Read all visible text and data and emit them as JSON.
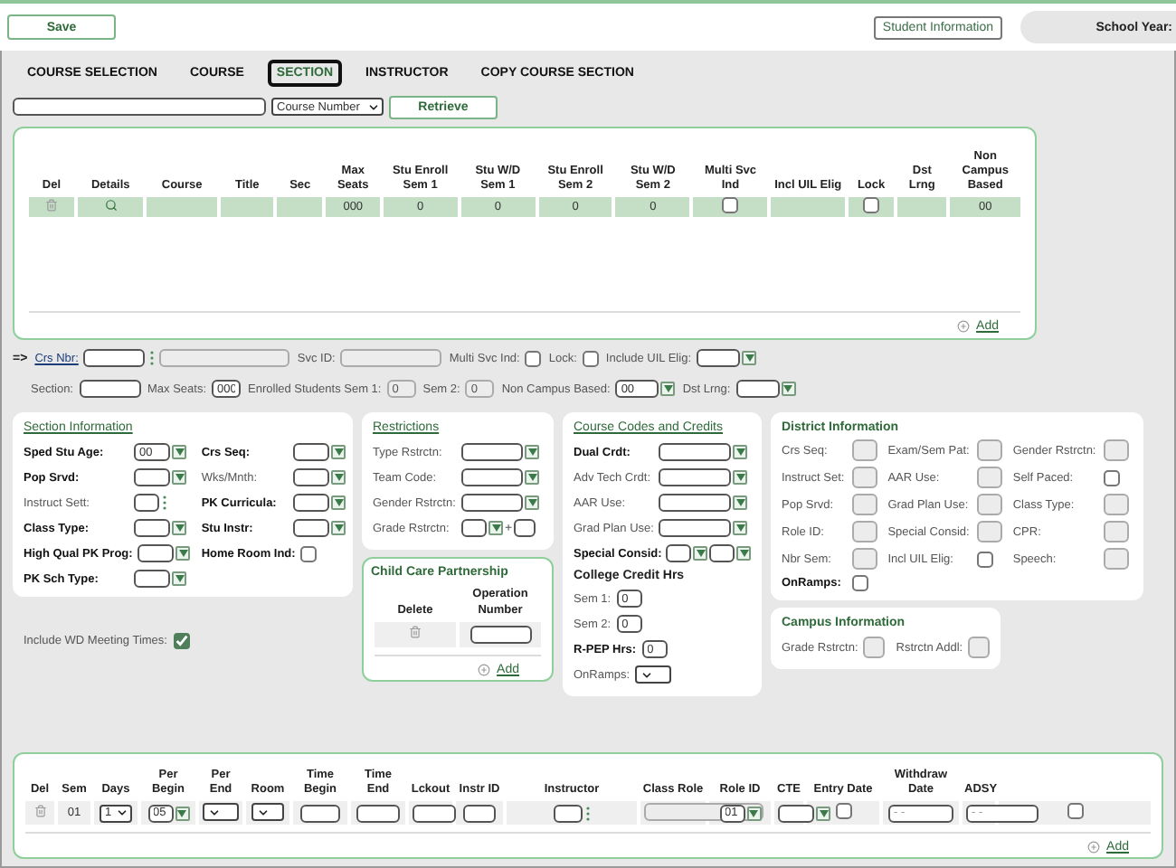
{
  "header": {
    "save_button": "Save",
    "student_info_button": "Student Information",
    "school_year_label": "School Year:"
  },
  "tabs": [
    {
      "label": "COURSE SELECTION",
      "selected": false
    },
    {
      "label": "COURSE",
      "selected": false
    },
    {
      "label": "SECTION",
      "selected": true
    },
    {
      "label": "INSTRUCTOR",
      "selected": false
    },
    {
      "label": "COPY COURSE SECTION",
      "selected": false
    }
  ],
  "search": {
    "type_select": "Course Number",
    "retrieve_button": "Retrieve"
  },
  "sections_table": {
    "columns": [
      "Del",
      "Details",
      "Course",
      "Title",
      "Sec",
      "Max Seats",
      "Stu Enroll Sem 1",
      "Stu W/D Sem 1",
      "Stu Enroll Sem 2",
      "Stu W/D Sem 2",
      "Multi Svc Ind",
      "Incl UIL Elig",
      "Lock",
      "Dst Lrng",
      "Non Campus Based"
    ],
    "rows": [
      {
        "cells": [
          {
            "kind": "delete"
          },
          {
            "kind": "details"
          },
          {
            "kind": "text"
          },
          {
            "kind": "text"
          },
          {
            "kind": "text"
          },
          {
            "kind": "text",
            "value": "000"
          },
          {
            "kind": "text",
            "value": "0"
          },
          {
            "kind": "text",
            "value": "0"
          },
          {
            "kind": "text",
            "value": "0"
          },
          {
            "kind": "text",
            "value": "0"
          },
          {
            "kind": "checkbox",
            "checked": false
          },
          {
            "kind": "text"
          },
          {
            "kind": "checkbox",
            "checked": false
          },
          {
            "kind": "text"
          },
          {
            "kind": "text",
            "value": "00"
          }
        ]
      }
    ],
    "add_link": "Add"
  },
  "section_detail": {
    "arrow": "=>",
    "lines": [
      [
        {
          "label": "Crs Nbr:",
          "kind": "lookup",
          "link": true
        },
        {
          "label": "Svc ID:",
          "kind": "readonly"
        },
        {
          "label": "Multi Svc Ind:",
          "kind": "checkbox",
          "checked": false
        },
        {
          "label": "Lock:",
          "kind": "checkbox",
          "checked": false
        },
        {
          "label": "Include UIL Elig:",
          "kind": "combo"
        }
      ],
      [
        {
          "label": "Section:",
          "kind": "input"
        },
        {
          "label": "Max Seats:",
          "kind": "input",
          "value": "000"
        },
        {
          "label": "Enrolled Students Sem 1:",
          "kind": "readonly",
          "value": "0"
        },
        {
          "label": "Sem 2:",
          "kind": "readonly",
          "value": "0"
        },
        {
          "label": "Non Campus Based:",
          "kind": "combo",
          "value": "00"
        },
        {
          "label": "Dst Lrng:",
          "kind": "combo"
        }
      ]
    ]
  },
  "section_information": {
    "title": "Section Information",
    "link": true,
    "columns": [
      [
        {
          "label": "Sped Stu Age:",
          "kind": "combo",
          "value": "00",
          "bold": true
        },
        {
          "label": "Pop Srvd:",
          "kind": "combo",
          "bold": true
        },
        {
          "label": "Instruct Sett:",
          "kind": "dots-input",
          "bold": false
        },
        {
          "label": "Class Type:",
          "kind": "combo",
          "bold": true
        },
        {
          "label": "High Qual PK Prog:",
          "kind": "combo",
          "bold": true
        },
        {
          "label": "PK Sch Type:",
          "kind": "combo",
          "bold": true
        }
      ],
      [
        {
          "label": "Crs Seq:",
          "kind": "combo",
          "bold": true
        },
        {
          "label": "Wks/Mnth:",
          "kind": "combo",
          "bold": false
        },
        {
          "label": "PK Curricula:",
          "kind": "combo",
          "bold": true
        },
        {
          "label": "Stu Instr:",
          "kind": "combo",
          "bold": true
        },
        {
          "label": "Home Room Ind:",
          "kind": "checkbox",
          "checked": false,
          "bold": true
        }
      ]
    ]
  },
  "include_wd": {
    "label": "Include WD Meeting Times:",
    "checked": true
  },
  "restrictions": {
    "title": "Restrictions",
    "link": true,
    "fields": [
      {
        "label": "Type Rstrctn:",
        "kind": "combo",
        "bold": false
      },
      {
        "label": "Team Code:",
        "kind": "combo",
        "bold": false
      },
      {
        "label": "Gender Rstrctn:",
        "kind": "combo",
        "bold": false
      },
      {
        "label": "Grade Rstrctn:",
        "kind": "range",
        "separator": "+",
        "bold": false
      }
    ]
  },
  "child_care": {
    "title": "Child Care Partnership",
    "link": false,
    "columns": [
      "Delete",
      "Operation Number"
    ],
    "rows": [
      {
        "cells": [
          {
            "kind": "delete"
          },
          {
            "kind": "input"
          }
        ]
      }
    ],
    "add_link": "Add"
  },
  "course_codes": {
    "title": "Course Codes and Credits",
    "link": true,
    "fields": [
      {
        "label": "Dual Crdt:",
        "kind": "combo",
        "bold": true
      },
      {
        "label": "Adv Tech Crdt:",
        "kind": "combo",
        "bold": false
      },
      {
        "label": "AAR Use:",
        "kind": "combo",
        "bold": false
      },
      {
        "label": "Grad Plan Use:",
        "kind": "combo",
        "bold": false
      },
      {
        "label": "Special Consid:",
        "kind": "double-combo",
        "bold": true
      },
      {
        "label": "College Credit Hrs",
        "kind": "heading",
        "bold": true
      },
      {
        "label": "Sem 1:",
        "kind": "input",
        "value": "0",
        "bold": false
      },
      {
        "label": "Sem 2:",
        "kind": "input",
        "value": "0",
        "bold": false
      },
      {
        "label": "R-PEP Hrs:",
        "kind": "input",
        "value": "0",
        "bold": true
      },
      {
        "label": "OnRamps:",
        "kind": "select",
        "bold": false
      }
    ]
  },
  "district_information": {
    "title": "District Information",
    "link": false,
    "fields": [
      {
        "label": "Crs Seq:",
        "kind": "readonly",
        "bold": false
      },
      {
        "label": "Exam/Sem Pat:",
        "kind": "readonly",
        "bold": false
      },
      {
        "label": "Gender Rstrctn:",
        "kind": "readonly",
        "bold": false
      },
      {
        "label": "Instruct Set:",
        "kind": "readonly",
        "bold": false
      },
      {
        "label": "AAR Use:",
        "kind": "readonly",
        "bold": false
      },
      {
        "label": "Self Paced:",
        "kind": "checkbox",
        "checked": false,
        "bold": false
      },
      {
        "label": "Pop Srvd:",
        "kind": "readonly",
        "bold": false
      },
      {
        "label": "Grad Plan Use:",
        "kind": "readonly",
        "bold": false
      },
      {
        "label": "Class Type:",
        "kind": "readonly",
        "bold": false
      },
      {
        "label": "Role ID:",
        "kind": "readonly",
        "bold": false
      },
      {
        "label": "Special Consid:",
        "kind": "readonly",
        "bold": false
      },
      {
        "label": "CPR:",
        "kind": "readonly",
        "bold": false
      },
      {
        "label": "Nbr Sem:",
        "kind": "readonly",
        "bold": false
      },
      {
        "label": "Incl UIL Elig:",
        "kind": "checkbox",
        "checked": false,
        "bold": false
      },
      {
        "label": "Speech:",
        "kind": "readonly",
        "bold": false
      },
      {
        "label": "OnRamps:",
        "kind": "checkbox",
        "checked": false,
        "bold": true
      }
    ]
  },
  "campus_information": {
    "title": "Campus Information",
    "link": false,
    "fields": [
      {
        "label": "Grade Rstrctn:",
        "kind": "readonly",
        "bold": false
      },
      {
        "label": "Rstrctn Addl:",
        "kind": "readonly",
        "bold": false
      }
    ]
  },
  "meetings_table": {
    "columns": [
      "Del",
      "Sem",
      "Days",
      "Per Begin",
      "Per End",
      "Room",
      "Time Begin",
      "Time End",
      "Lckout",
      "Instr ID",
      "Instructor",
      "Class Role",
      "Role ID",
      "CTE",
      "Entry Date",
      "Withdraw Date",
      "ADSY"
    ],
    "rows": [
      {
        "cells": [
          {
            "kind": "delete"
          },
          {
            "kind": "text",
            "value": "01"
          },
          {
            "kind": "select",
            "value": "1"
          },
          {
            "kind": "combo",
            "value": "05"
          },
          {
            "kind": "select"
          },
          {
            "kind": "select"
          },
          {
            "kind": "input"
          },
          {
            "kind": "input"
          },
          {
            "kind": "input"
          },
          {
            "kind": "input"
          },
          {
            "kind": "dots-input"
          },
          {
            "kind": "readonly"
          },
          {
            "kind": "combo",
            "value": "01"
          },
          {
            "kind": "combo"
          },
          {
            "kind": "checkbox",
            "checked": false
          },
          {
            "kind": "input",
            "placeholder": "- -"
          },
          {
            "kind": "input",
            "placeholder": "- -"
          },
          {
            "kind": "checkbox",
            "checked": false
          }
        ]
      }
    ],
    "add_link": "Add"
  }
}
